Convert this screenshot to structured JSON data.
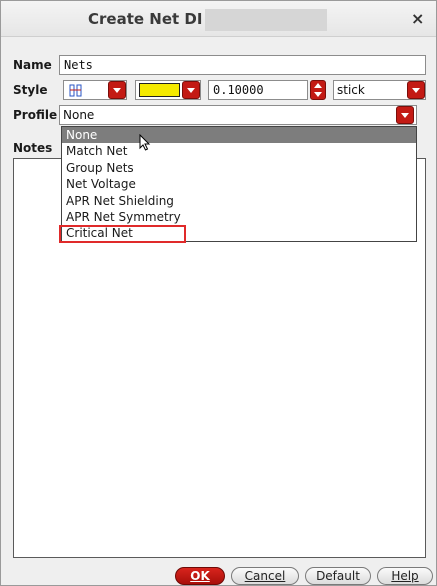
{
  "window": {
    "title": "Create Net DI -",
    "close_glyph": "×"
  },
  "form": {
    "name_label": "Name",
    "name_value": "Nets",
    "style_label": "Style",
    "style_icon": "net-style-icon",
    "color_swatch": "#f5ea00",
    "width_value": "0.10000",
    "line_type": "stick",
    "profile_label": "Profile",
    "profile_value": "None",
    "notes_label": "Notes"
  },
  "profile_options": [
    "None",
    "Match Net",
    "Group Nets",
    "Net Voltage",
    "APR Net Shielding",
    "APR Net Symmetry",
    "Critical Net"
  ],
  "buttons": {
    "ok": "OK",
    "cancel": "Cancel",
    "default": "Default",
    "help": "Help"
  },
  "colors": {
    "accent_red": "#c31a14",
    "highlight_red": "#e02a2a",
    "selection_gray": "#7d7d7d"
  }
}
